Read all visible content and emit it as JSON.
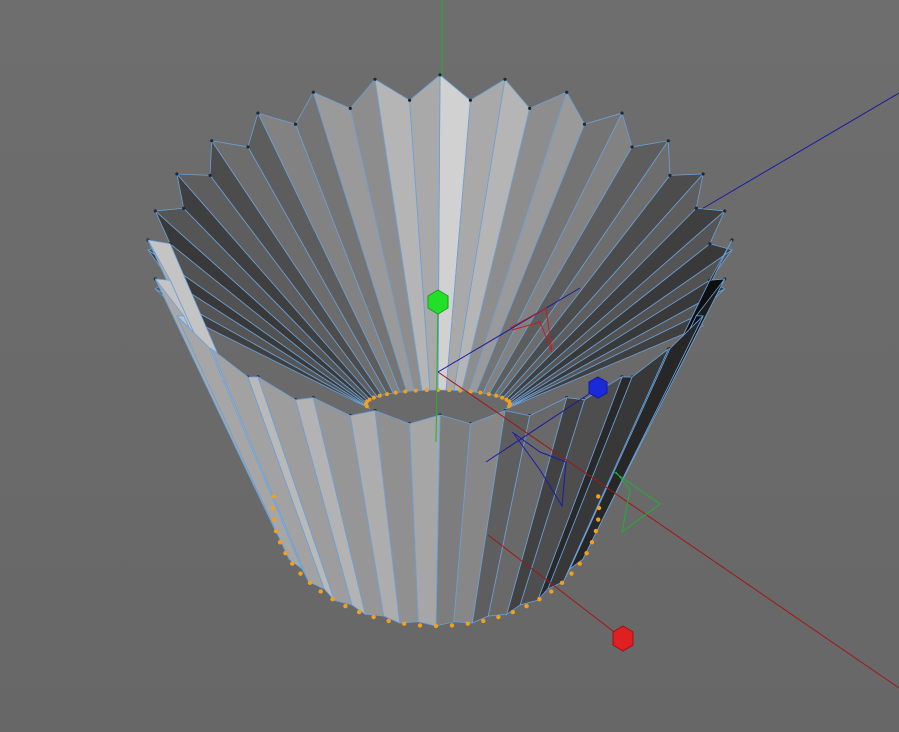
{
  "viewport": {
    "background_color": "#6c6c6c",
    "object": {
      "type": "cupcake-liner",
      "shape": "open fluted frustum",
      "pleat_count": 28,
      "edge_color": "#6aa0d8",
      "surface_light": "#d4d4d4",
      "surface_shadow": "#141414"
    },
    "selection": {
      "mode": "edge-loop",
      "selected_loops": [
        "inner-bottom-rim",
        "outer-bottom-rim"
      ],
      "selection_color": "#f0a020"
    },
    "axes": {
      "x_color": "#b02020",
      "y_color": "#20b030",
      "z_color": "#1a1aa0"
    },
    "manipulator": {
      "x_handle": "red-hexagon",
      "y_handle": "green-hexagon",
      "z_handle": "blue-hexagon"
    }
  }
}
